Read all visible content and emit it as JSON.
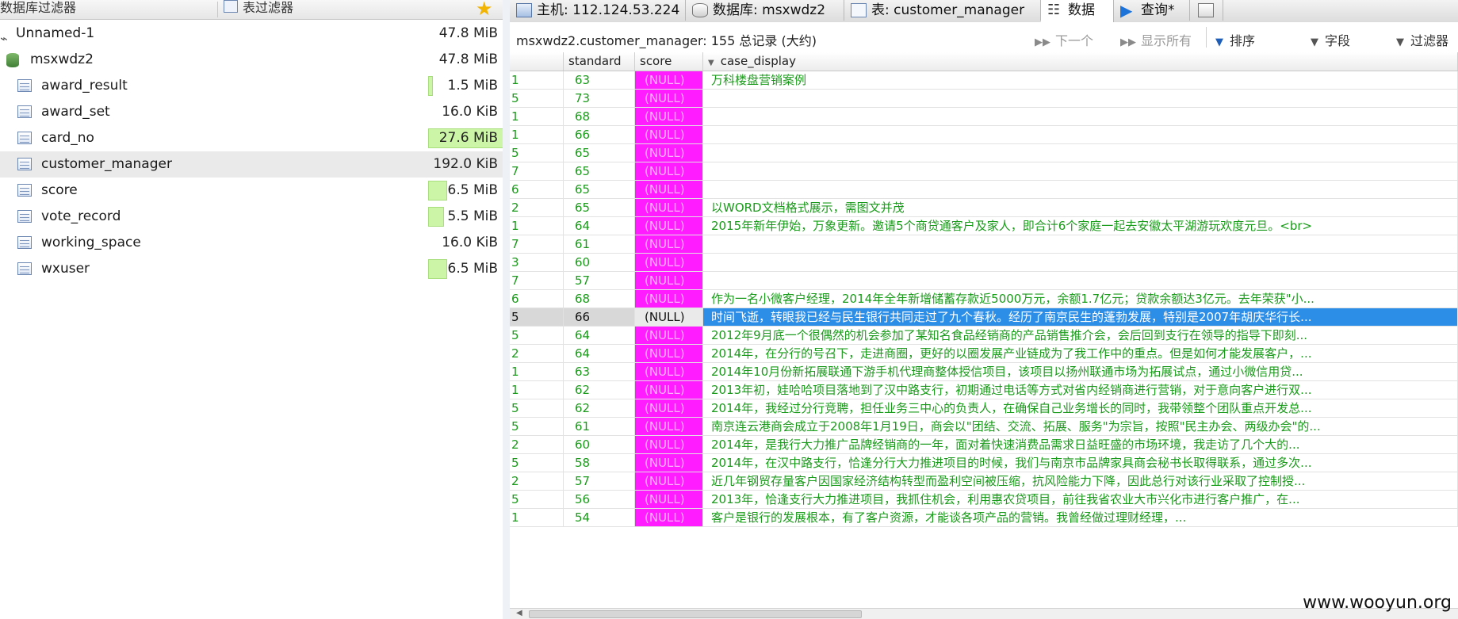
{
  "left_pane": {
    "filter_db": "数据库过滤器",
    "filter_table": "表过滤器",
    "tree": [
      {
        "name": "Unnamed-1",
        "size": "47.8 MiB",
        "kind": "connection"
      },
      {
        "name": "msxwdz2",
        "size": "47.8 MiB",
        "kind": "database"
      },
      {
        "name": "award_result",
        "size": "1.5 MiB",
        "kind": "table",
        "usage": 0.05
      },
      {
        "name": "award_set",
        "size": "16.0 KiB",
        "kind": "table",
        "usage": 0
      },
      {
        "name": "card_no",
        "size": "27.6 MiB",
        "kind": "table",
        "usage": 1.0
      },
      {
        "name": "customer_manager",
        "size": "192.0 KiB",
        "kind": "table",
        "usage": 0,
        "selected": true
      },
      {
        "name": "score",
        "size": "6.5 MiB",
        "kind": "table",
        "usage": 0.24
      },
      {
        "name": "vote_record",
        "size": "5.5 MiB",
        "kind": "table",
        "usage": 0.2
      },
      {
        "name": "working_space",
        "size": "16.0 KiB",
        "kind": "table",
        "usage": 0
      },
      {
        "name": "wxuser",
        "size": "6.5 MiB",
        "kind": "table",
        "usage": 0.24
      }
    ]
  },
  "tabs": [
    {
      "label": "主机: 112.124.53.224",
      "icon": "host-icon"
    },
    {
      "label": "数据库: msxwdz2",
      "icon": "database-icon"
    },
    {
      "label": "表: customer_manager",
      "icon": "table-icon"
    },
    {
      "label": "数据",
      "icon": "data-grid-icon",
      "active": true
    },
    {
      "label": "查询*",
      "icon": "play-icon"
    },
    {
      "label": "",
      "icon": "new-tab-icon"
    }
  ],
  "infobar": {
    "text": "msxwdz2.customer_manager: 155 总记录 (大约)",
    "next": "下一个",
    "show_all": "显示所有",
    "sort": "排序",
    "columns": "字段",
    "filter": "过滤器"
  },
  "grid": {
    "columns": [
      "",
      "standard",
      "score",
      "case_display"
    ],
    "null_text": "(NULL)",
    "rows": [
      {
        "id": "1",
        "standard": "63",
        "case": "万科楼盘营销案例"
      },
      {
        "id": "5",
        "standard": "73",
        "case": ""
      },
      {
        "id": "1",
        "standard": "68",
        "case": ""
      },
      {
        "id": "1",
        "standard": "66",
        "case": ""
      },
      {
        "id": "5",
        "standard": "65",
        "case": ""
      },
      {
        "id": "7",
        "standard": "65",
        "case": ""
      },
      {
        "id": "6",
        "standard": "65",
        "case": ""
      },
      {
        "id": "2",
        "standard": "65",
        "case": "以WORD文档格式展示，需图文并茂"
      },
      {
        "id": "1",
        "standard": "64",
        "case": "2015年新年伊始，万象更新。邀请5个商贷通客户及家人，即合计6个家庭一起去安徽太平湖游玩欢度元旦。<br>"
      },
      {
        "id": "7",
        "standard": "61",
        "case": ""
      },
      {
        "id": "3",
        "standard": "60",
        "case": ""
      },
      {
        "id": "7",
        "standard": "57",
        "case": ""
      },
      {
        "id": "6",
        "standard": "68",
        "case": "作为一名小微客户经理，2014年全年新增储蓄存款近5000万元，余额1.7亿元；贷款余额达3亿元。去年荣获\"小..."
      },
      {
        "id": "5",
        "standard": "66",
        "case": "时间飞逝，转眼我已经与民生银行共同走过了九个春秋。经历了南京民生的蓬勃发展，特别是2007年胡庆华行长...",
        "selected": true
      },
      {
        "id": "5",
        "standard": "64",
        "case": "2012年9月底一个很偶然的机会参加了某知名食品经销商的产品销售推介会，会后回到支行在领导的指导下即刻..."
      },
      {
        "id": "2",
        "standard": "64",
        "case": "2014年，在分行的号召下，走进商圈，更好的以圈发展产业链成为了我工作中的重点。但是如何才能发展客户，..."
      },
      {
        "id": "1",
        "standard": "63",
        "case": " 2014年10月份新拓展联通下游手机代理商整体授信项目，该项目以扬州联通市场为拓展试点，通过小微信用贷..."
      },
      {
        "id": "1",
        "standard": "62",
        "case": "2013年初，娃哈哈项目落地到了汉中路支行，初期通过电话等方式对省内经销商进行营销，对于意向客户进行双..."
      },
      {
        "id": "5",
        "standard": "62",
        "case": "2014年，我经过分行竞聘，担任业务三中心的负责人，在确保自己业务增长的同时，我带领整个团队重点开发总..."
      },
      {
        "id": "5",
        "standard": "61",
        "case": "南京连云港商会成立于2008年1月19日，商会以\"团结、交流、拓展、服务\"为宗旨，按照\"民主办会、两级办会\"的..."
      },
      {
        "id": "2",
        "standard": "60",
        "case": " 2014年，是我行大力推广品牌经销商的一年，面对着快速消费品需求日益旺盛的市场环境，我走访了几个大的..."
      },
      {
        "id": "5",
        "standard": "58",
        "case": "2014年，在汉中路支行，恰逢分行大力推进项目的时候，我们与南京市品牌家具商会秘书长取得联系，通过多次..."
      },
      {
        "id": "2",
        "standard": "57",
        "case": "近几年钢贸存量客户因国家经济结构转型而盈利空间被压缩，抗风险能力下降，因此总行对该行业采取了控制授..."
      },
      {
        "id": "5",
        "standard": "56",
        "case": " 2013年，恰逢支行大力推进项目，我抓住机会，利用惠农贷项目，前往我省农业大市兴化市进行客户推广，在..."
      },
      {
        "id": "1",
        "standard": "54",
        "case": "客户是银行的发展根本，有了客户资源，才能谈各项产品的营销。我曾经做过理财经理，..."
      }
    ]
  },
  "watermark": "www.wooyun.org",
  "colors": {
    "null_bg": "#ff1dff",
    "text_green": "#1a9a1a",
    "selection": "#2d8ee8",
    "bar": "#ccf5a8"
  }
}
